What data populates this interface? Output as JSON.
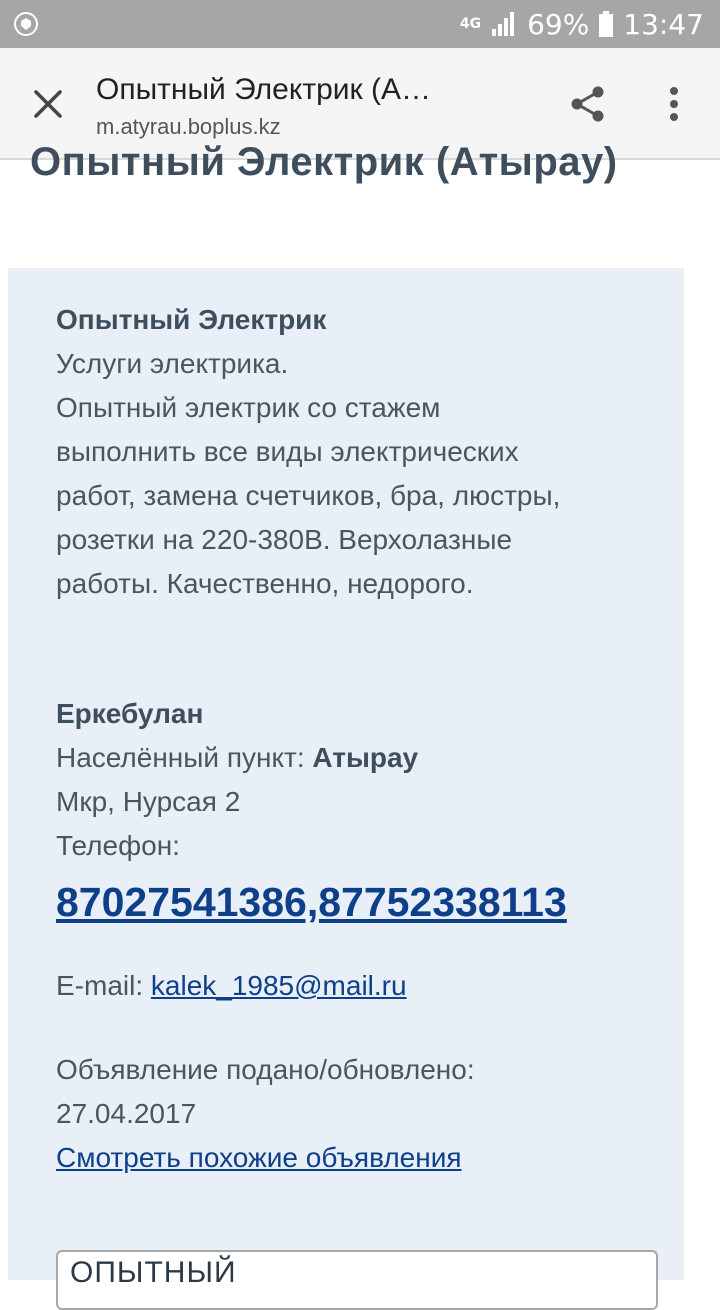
{
  "status": {
    "network": "4G",
    "battery": "69%",
    "time": "13:47"
  },
  "browser": {
    "title": "Опытный Электрик (А…",
    "url": "m.atyrau.boplus.kz"
  },
  "page": {
    "heading": "Опытный Электрик (Атырау)",
    "ad": {
      "title": "Опытный Электрик",
      "body": [
        "Услуги электрика.",
        "Опытный электрик со стажем",
        "выполнить все виды электрических",
        "работ, замена счетчиков, бра, люстры,",
        "розетки на 220-380В. Верхолазные",
        "работы. Качественно, недорого."
      ],
      "contact_name": "Еркебулан",
      "locality_label": "Населённый пункт:",
      "locality_value": "Атырау",
      "address": "Мкр, Нурсая 2",
      "phone_label": "Телефон:",
      "phone": "87027541386,87752338113",
      "email_label": "E-mail:",
      "email": "kalek_1985@mail.ru",
      "posted_label": "Объявление подано/обновлено:",
      "posted_date": "27.04.2017",
      "similar_link": "Смотреть похожие объявления",
      "search_value": "опытный"
    }
  },
  "colors": {
    "statusbar": "#a6a6a6",
    "toolbar": "#f5f5f5",
    "card": "#e8eff6",
    "link": "#0d3f8a",
    "heading": "#3f4e5c"
  },
  "icons": [
    "shield-icon",
    "signal-icon",
    "battery-icon",
    "close-icon",
    "share-icon",
    "more-vert-icon"
  ]
}
